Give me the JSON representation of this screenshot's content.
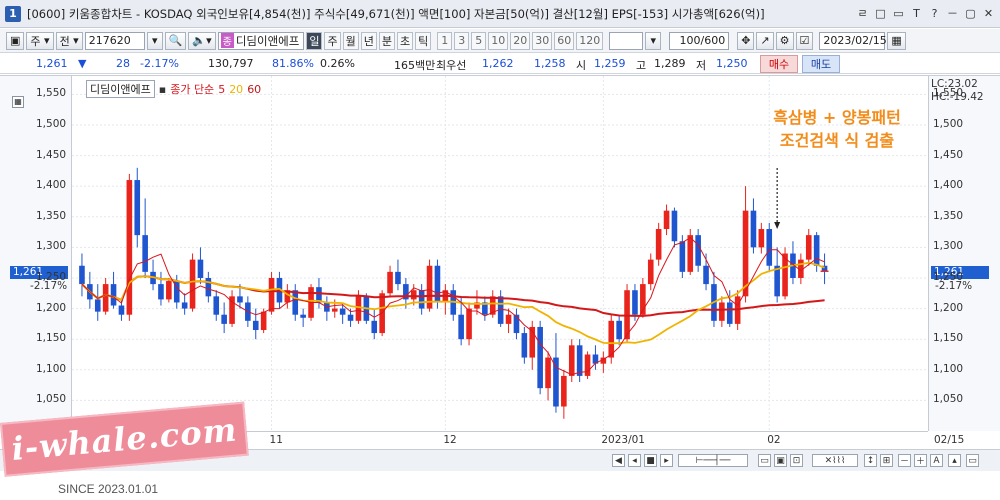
{
  "window": {
    "badge": "1",
    "title": "[0600] 키움종합차트 - KOSDAQ 외국인보유[4,854(천)] 주식수[49,671(천)] 액면[100] 자본금[50(억)] 결산[12월] EPS[-153] 시가총액[626(억)]",
    "controls": [
      "ㄹ",
      "□",
      "▭",
      "T",
      "?",
      "－",
      "▢",
      "✕"
    ]
  },
  "toolbar": {
    "type_label": "주",
    "market_label": "전",
    "code": "217620",
    "stock_name": "디딤이앤에프",
    "stock_tag": "종",
    "periods": [
      "일",
      "주",
      "월",
      "년",
      "분",
      "초",
      "틱"
    ],
    "active_period": "일",
    "intervals": [
      "1",
      "3",
      "5",
      "10",
      "20",
      "30",
      "60",
      "120"
    ],
    "count": "100",
    "count_total": "/600",
    "date": "2023/02/15"
  },
  "pricebar": {
    "price": "1,261",
    "change_arrow": "▼",
    "change": "28",
    "change_pct": "-2.17%",
    "volume": "130,797",
    "vol_ratio": "81.86%",
    "turnover": "0.26%",
    "amount": "165백만",
    "bid_label": "최우선",
    "bid1": "1,262",
    "bid2": "1,258",
    "open_label": "시",
    "open": "1,259",
    "high_label": "고",
    "high": "1,289",
    "low_label": "저",
    "low": "1,250",
    "buy_label": "매수",
    "sell_label": "매도"
  },
  "legend": {
    "name": "디딤이앤에프",
    "ma_label": "종가 단순",
    "ma5": "5",
    "ma20": "20",
    "ma60": "60"
  },
  "right_info": {
    "lc": "LC:23.02",
    "hc": "HC:-19.42",
    "price": "1,261",
    "pct": "-2.17%"
  },
  "left_info": {
    "price": "1,261",
    "pct": "-2.17%"
  },
  "annotation": {
    "line1": "흑삼병 + 양봉패턴",
    "line2": "조건검색 식 검출"
  },
  "watermark": {
    "brand": "i-whale.com",
    "since": "SINCE 2023.01.01"
  },
  "colors": {
    "up": "#e8241c",
    "down": "#1f56d0",
    "ma5": "#d8161e",
    "ma20": "#f0b400",
    "ma60": "#d21818",
    "annot": "#f28c1a"
  },
  "chart_data": {
    "type": "candlestick",
    "ylim": [
      1000,
      1580
    ],
    "y_ticks": [
      1050,
      1100,
      1150,
      1200,
      1250,
      1300,
      1350,
      1400,
      1450,
      1500,
      1550
    ],
    "x_labels": [
      {
        "label": "11",
        "index": 24
      },
      {
        "label": "12",
        "index": 46
      },
      {
        "label": "2023/01",
        "index": 66
      },
      {
        "label": "02",
        "index": 87
      },
      {
        "label": "02/15",
        "index": 99
      }
    ],
    "candles": [
      [
        1270,
        1290,
        1220,
        1240
      ],
      [
        1240,
        1260,
        1200,
        1215
      ],
      [
        1215,
        1240,
        1180,
        1195
      ],
      [
        1195,
        1250,
        1190,
        1240
      ],
      [
        1240,
        1260,
        1200,
        1205
      ],
      [
        1205,
        1215,
        1180,
        1190
      ],
      [
        1190,
        1420,
        1180,
        1410
      ],
      [
        1410,
        1430,
        1300,
        1320
      ],
      [
        1320,
        1380,
        1250,
        1260
      ],
      [
        1260,
        1280,
        1230,
        1240
      ],
      [
        1240,
        1260,
        1205,
        1215
      ],
      [
        1215,
        1250,
        1210,
        1245
      ],
      [
        1245,
        1255,
        1200,
        1210
      ],
      [
        1210,
        1225,
        1190,
        1200
      ],
      [
        1200,
        1290,
        1195,
        1280
      ],
      [
        1280,
        1300,
        1240,
        1250
      ],
      [
        1250,
        1260,
        1210,
        1220
      ],
      [
        1220,
        1230,
        1180,
        1190
      ],
      [
        1190,
        1210,
        1160,
        1175
      ],
      [
        1175,
        1230,
        1170,
        1220
      ],
      [
        1220,
        1240,
        1200,
        1210
      ],
      [
        1210,
        1220,
        1170,
        1180
      ],
      [
        1180,
        1200,
        1150,
        1165
      ],
      [
        1165,
        1200,
        1160,
        1195
      ],
      [
        1195,
        1260,
        1190,
        1250
      ],
      [
        1250,
        1260,
        1200,
        1210
      ],
      [
        1210,
        1240,
        1200,
        1230
      ],
      [
        1230,
        1240,
        1180,
        1190
      ],
      [
        1190,
        1200,
        1170,
        1185
      ],
      [
        1185,
        1240,
        1180,
        1235
      ],
      [
        1235,
        1250,
        1200,
        1210
      ],
      [
        1210,
        1220,
        1180,
        1195
      ],
      [
        1195,
        1215,
        1185,
        1200
      ],
      [
        1200,
        1210,
        1175,
        1190
      ],
      [
        1190,
        1200,
        1170,
        1180
      ],
      [
        1180,
        1230,
        1175,
        1220
      ],
      [
        1220,
        1225,
        1175,
        1180
      ],
      [
        1180,
        1200,
        1150,
        1160
      ],
      [
        1160,
        1230,
        1155,
        1225
      ],
      [
        1225,
        1270,
        1220,
        1260
      ],
      [
        1260,
        1280,
        1230,
        1240
      ],
      [
        1240,
        1250,
        1200,
        1215
      ],
      [
        1215,
        1240,
        1205,
        1230
      ],
      [
        1230,
        1240,
        1190,
        1200
      ],
      [
        1200,
        1280,
        1195,
        1270
      ],
      [
        1270,
        1280,
        1200,
        1210
      ],
      [
        1210,
        1240,
        1190,
        1230
      ],
      [
        1230,
        1240,
        1180,
        1190
      ],
      [
        1190,
        1220,
        1140,
        1150
      ],
      [
        1150,
        1210,
        1140,
        1200
      ],
      [
        1200,
        1230,
        1190,
        1210
      ],
      [
        1210,
        1220,
        1180,
        1190
      ],
      [
        1190,
        1230,
        1185,
        1220
      ],
      [
        1220,
        1230,
        1170,
        1175
      ],
      [
        1175,
        1200,
        1160,
        1190
      ],
      [
        1190,
        1200,
        1150,
        1160
      ],
      [
        1160,
        1170,
        1110,
        1120
      ],
      [
        1120,
        1180,
        1100,
        1170
      ],
      [
        1170,
        1180,
        1060,
        1070
      ],
      [
        1070,
        1130,
        1050,
        1120
      ],
      [
        1120,
        1160,
        1030,
        1040
      ],
      [
        1040,
        1100,
        1020,
        1090
      ],
      [
        1090,
        1150,
        1080,
        1140
      ],
      [
        1140,
        1150,
        1080,
        1090
      ],
      [
        1090,
        1130,
        1085,
        1125
      ],
      [
        1125,
        1140,
        1100,
        1110
      ],
      [
        1110,
        1130,
        1095,
        1120
      ],
      [
        1120,
        1190,
        1110,
        1180
      ],
      [
        1180,
        1190,
        1140,
        1150
      ],
      [
        1150,
        1240,
        1145,
        1230
      ],
      [
        1230,
        1240,
        1180,
        1190
      ],
      [
        1190,
        1250,
        1185,
        1240
      ],
      [
        1240,
        1290,
        1230,
        1280
      ],
      [
        1280,
        1340,
        1270,
        1330
      ],
      [
        1330,
        1370,
        1320,
        1360
      ],
      [
        1360,
        1365,
        1300,
        1310
      ],
      [
        1310,
        1320,
        1250,
        1260
      ],
      [
        1260,
        1330,
        1255,
        1320
      ],
      [
        1320,
        1330,
        1260,
        1270
      ],
      [
        1270,
        1290,
        1230,
        1240
      ],
      [
        1240,
        1260,
        1170,
        1180
      ],
      [
        1180,
        1220,
        1170,
        1210
      ],
      [
        1210,
        1230,
        1170,
        1175
      ],
      [
        1175,
        1230,
        1165,
        1220
      ],
      [
        1220,
        1400,
        1210,
        1360
      ],
      [
        1360,
        1380,
        1290,
        1300
      ],
      [
        1300,
        1340,
        1290,
        1330
      ],
      [
        1330,
        1340,
        1260,
        1270
      ],
      [
        1270,
        1300,
        1210,
        1220
      ],
      [
        1220,
        1300,
        1215,
        1290
      ],
      [
        1290,
        1310,
        1240,
        1250
      ],
      [
        1250,
        1290,
        1240,
        1280
      ],
      [
        1280,
        1330,
        1270,
        1320
      ],
      [
        1320,
        1325,
        1260,
        1270
      ],
      [
        1270,
        1290,
        1240,
        1261
      ]
    ]
  }
}
